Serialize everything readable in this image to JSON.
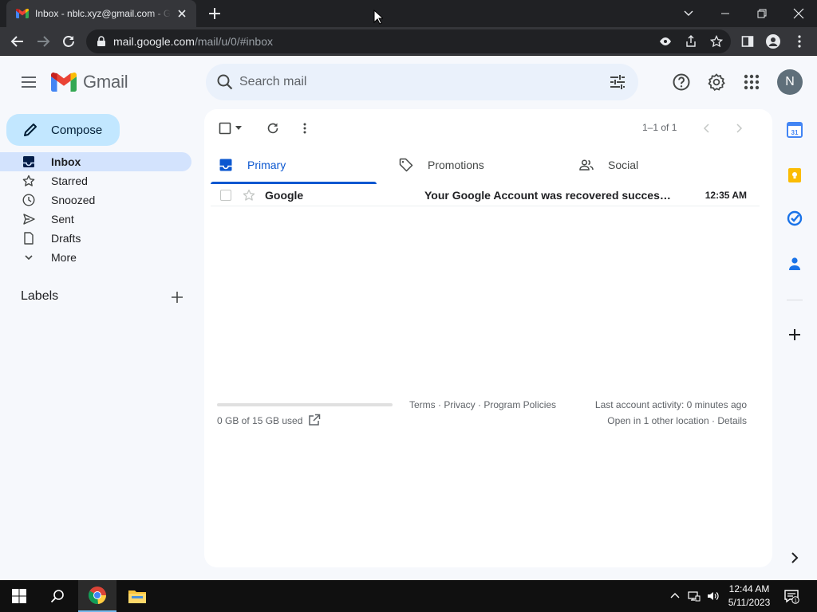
{
  "browser": {
    "tab_title": "Inbox - nblc.xyz@gmail.com - Gmail",
    "url_host": "mail.google.com",
    "url_path": "/mail/u/0/#inbox"
  },
  "gmail": {
    "logo_text": "Gmail",
    "search_placeholder": "Search mail",
    "avatar_initial": "N",
    "compose_label": "Compose",
    "nav": [
      {
        "label": "Inbox"
      },
      {
        "label": "Starred"
      },
      {
        "label": "Snoozed"
      },
      {
        "label": "Sent"
      },
      {
        "label": "Drafts"
      },
      {
        "label": "More"
      }
    ],
    "labels_title": "Labels",
    "pager": "1–1 of 1",
    "tabs": [
      {
        "label": "Primary"
      },
      {
        "label": "Promotions"
      },
      {
        "label": "Social"
      }
    ],
    "emails": [
      {
        "sender": "Google",
        "subject": "Your Google Account was recovered successfully",
        "time": "12:35 AM"
      }
    ],
    "storage_text": "0 GB of 15 GB used",
    "storage_fraction": 0.0,
    "footer_links": "Terms · Privacy · Program Policies",
    "activity_line1": "Last account activity: 0 minutes ago",
    "activity_line2": "Open in 1 other location · Details"
  },
  "taskbar": {
    "time": "12:44 AM",
    "date": "5/11/2023",
    "notification_count": "1"
  },
  "colors": {
    "accent": "#0b57d0",
    "compose_bg": "#c2e7ff",
    "active_nav": "#d3e3fd",
    "gmail_red": "#ea4335"
  }
}
